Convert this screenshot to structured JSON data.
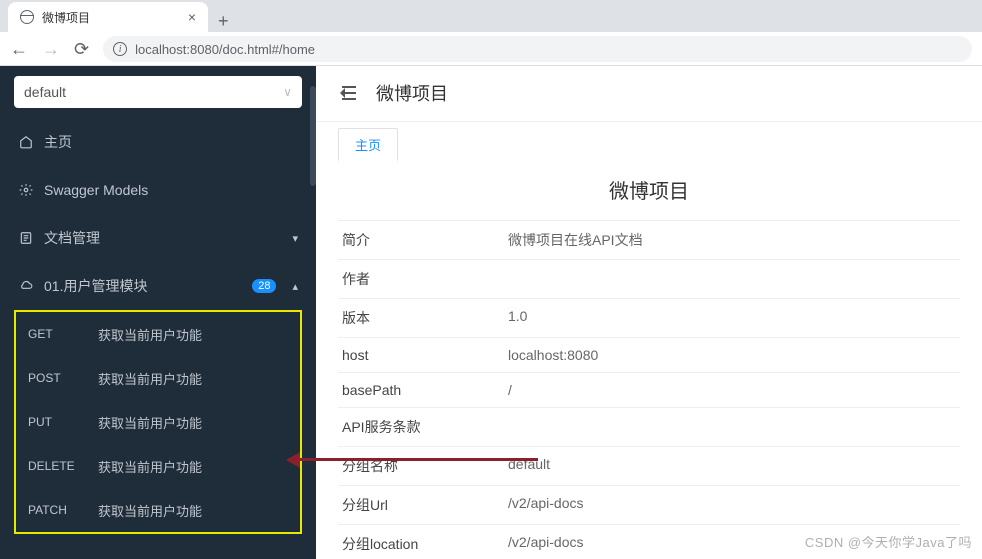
{
  "browser": {
    "tab_title": "微博项目",
    "url": "localhost:8080/doc.html#/home"
  },
  "sidebar": {
    "selector_value": "default",
    "items": [
      {
        "icon": "home",
        "label": "主页"
      },
      {
        "icon": "models",
        "label": "Swagger Models"
      },
      {
        "icon": "docs",
        "label": "文档管理",
        "has_sub": true
      },
      {
        "icon": "cloud",
        "label": "01.用户管理模块",
        "badge": "28",
        "expanded": true
      }
    ],
    "api_list": [
      {
        "method": "GET",
        "name": "获取当前用户功能"
      },
      {
        "method": "POST",
        "name": "获取当前用户功能"
      },
      {
        "method": "PUT",
        "name": "获取当前用户功能"
      },
      {
        "method": "DELETE",
        "name": "获取当前用户功能"
      },
      {
        "method": "PATCH",
        "name": "获取当前用户功能"
      }
    ]
  },
  "main": {
    "header_title": "微博项目",
    "tab_label": "主页",
    "page_title": "微博项目",
    "rows": [
      {
        "label": "简介",
        "value": "微博项目在线API文档"
      },
      {
        "label": "作者",
        "value": ""
      },
      {
        "label": "版本",
        "value": "1.0"
      },
      {
        "label": "host",
        "value": "localhost:8080"
      },
      {
        "label": "basePath",
        "value": "/"
      },
      {
        "label": "API服务条款",
        "value": ""
      },
      {
        "label": "分组名称",
        "value": "default"
      },
      {
        "label": "分组Url",
        "value": "/v2/api-docs"
      },
      {
        "label": "分组location",
        "value": "/v2/api-docs"
      }
    ]
  },
  "watermark": "CSDN @今天你学Java了吗"
}
